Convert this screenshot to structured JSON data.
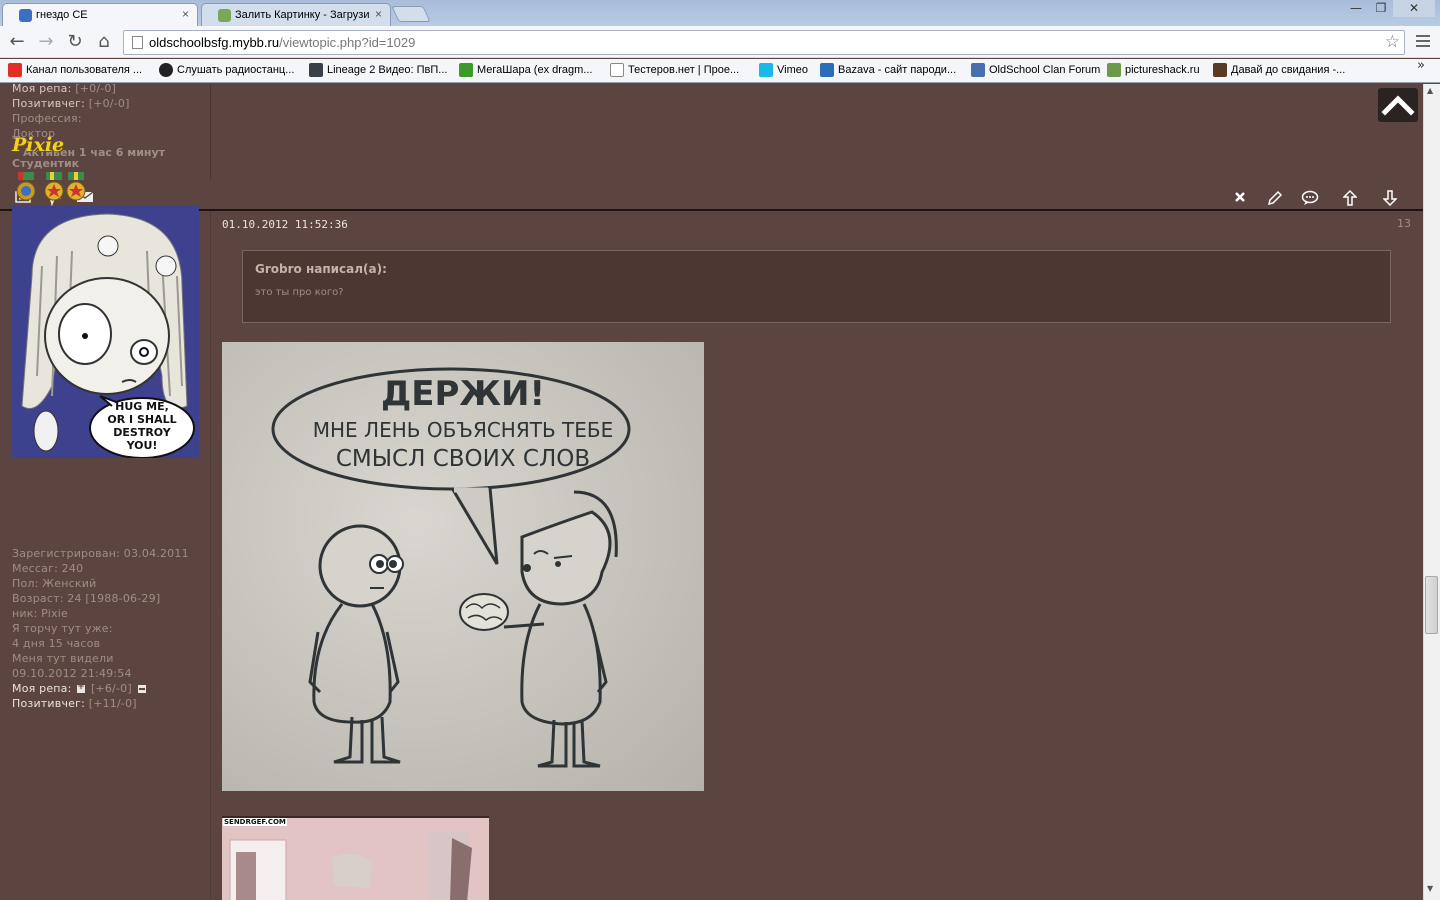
{
  "tabs": [
    {
      "title": "гнездо СЕ"
    },
    {
      "title": "Залить Картинку - Загрузи"
    }
  ],
  "window_controls": {
    "minimize": "—",
    "restore": "❐",
    "close": "✕"
  },
  "address_bar": {
    "host": "oldschoolbsfg.mybb.ru",
    "path": "/viewtopic.php?id=1029"
  },
  "bookmarks": [
    {
      "label": "Канал пользователя ...",
      "icon": "youtube-icon",
      "color": "#e52d27"
    },
    {
      "label": "Слушать радиостанц...",
      "icon": "paw-icon",
      "color": "#222222"
    },
    {
      "label": "Lineage 2 Видео: ПвП...",
      "icon": "lineage-icon",
      "color": "#3a3f4a"
    },
    {
      "label": "МегаШара (ex dragm...",
      "icon": "megashara-icon",
      "color": "#3a9a2a"
    },
    {
      "label": "Тестеров.нет | Прое...",
      "icon": "page-icon",
      "color": "#ffffff"
    },
    {
      "label": "Vimeo",
      "icon": "vimeo-icon",
      "color": "#1ab7ea"
    },
    {
      "label": "Bazava - сайт пароди...",
      "icon": "bazava-icon",
      "color": "#2a6fb5"
    },
    {
      "label": "OldSchool Clan Forum",
      "icon": "forum-icon",
      "color": "#4a6fb0"
    },
    {
      "label": "pictureshack.ru",
      "icon": "pictureshack-icon",
      "color": "#6d9a4a"
    },
    {
      "label": "Давай до свидания -...",
      "icon": "ta-icon",
      "color": "#5a3a22"
    }
  ],
  "prev_post_profile": {
    "rep_label": "Моя репа:",
    "rep_value": "[+0/-0]",
    "pos_label": "Позитивчег:",
    "pos_value": "[+0/-0]",
    "profession_label": "Профессия:",
    "profession_value": "Доктор",
    "active": "Активен 1 час 6 минут"
  },
  "author": {
    "name": "Pixie",
    "rank": "Студентик",
    "avatar_caption": [
      "HUG ME,",
      "OR I SHALL",
      "DESTROY",
      "YOU!"
    ],
    "info": [
      "Зарегистрирован: 03.04.2011",
      "Мессаг: 240",
      "Пол: Женский",
      "Возраст: 24 [1988-06-29]",
      "ник: Pixie",
      "Я торчу тут уже:",
      "4 дня 15 часов",
      "Меня тут видели",
      "09.10.2012 21:49:54"
    ],
    "rep_label": "Моя репа:",
    "rep_value": "[+6/-0]",
    "pos_label": "Позитивчег:",
    "pos_value": "[+11/-0]"
  },
  "post": {
    "date": "01.10.2012 11:52:36",
    "number": "13",
    "quote_author": "Grobro написал(а):",
    "quote_text": "это ты про кого?",
    "comic_lines": [
      "ДЕРЖИ!",
      "МНЕ ЛЕНЬ ОБЪЯСНЯТЬ ТЕБЕ",
      "СМЫСЛ СВОИХ СЛОВ"
    ],
    "gif_label": "SENDRGEF.COM"
  }
}
